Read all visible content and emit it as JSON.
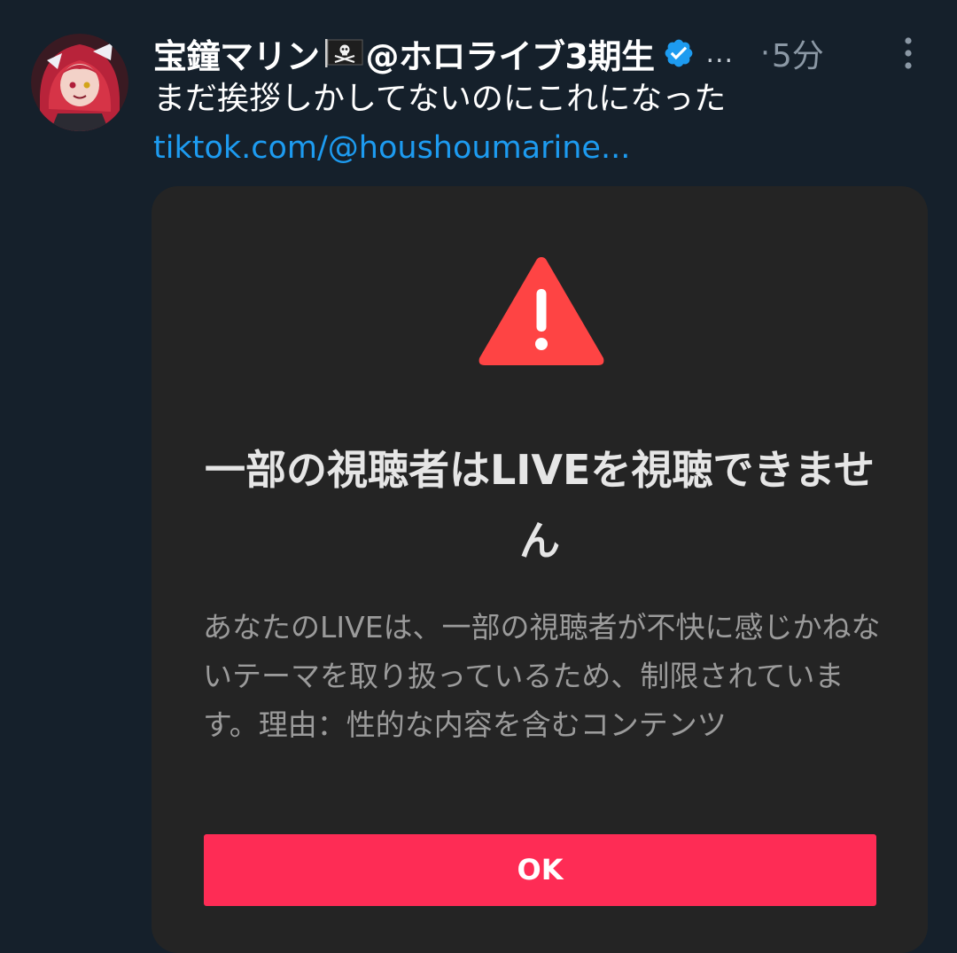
{
  "tweet": {
    "display_name": "宝鐘マリン",
    "display_name_suffix": "@ホロライブ3期生",
    "name_truncation": "...",
    "dot_separator": "·",
    "timestamp": "5分",
    "text": "まだ挨拶しかしてないのにこれになった",
    "link": "tiktok.com/@houshoumarine..."
  },
  "embedded_screenshot": {
    "title": "一部の視聴者はLIVEを視聴できません",
    "body": "あなたのLIVEは、一部の視聴者が不快に感じかねないテーマを取り扱っているため、制限されています。理由：性的な内容を含むコンテンツ",
    "ok_button_label": "OK"
  },
  "icons": {
    "avatar": "avatar-image",
    "flag": "pirate-flag-icon",
    "verified": "verified-badge-icon",
    "more": "more-vertical-icon",
    "warning": "warning-triangle-icon"
  },
  "colors": {
    "background": "#15202b",
    "link": "#1d9bf0",
    "verified": "#1d9bf0",
    "card_background": "#242424",
    "warning": "#fe4444",
    "ok_button": "#fe2c55"
  }
}
